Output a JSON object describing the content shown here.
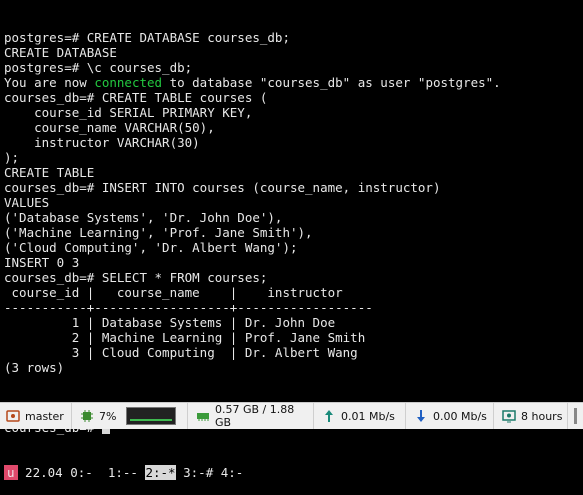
{
  "terminal": {
    "lines": [
      "postgres=# CREATE DATABASE courses_db;",
      "CREATE DATABASE",
      "postgres=# \\c courses_db;",
      {
        "pre": "You are now ",
        "hl": "connected",
        "post": " to database \"courses_db\" as user \"postgres\"."
      },
      "courses_db=# CREATE TABLE courses (",
      "    course_id SERIAL PRIMARY KEY,",
      "    course_name VARCHAR(50),",
      "    instructor VARCHAR(30)",
      ");",
      "CREATE TABLE",
      "courses_db=# INSERT INTO courses (course_name, instructor)",
      "VALUES",
      "('Database Systems', 'Dr. John Doe'),",
      "('Machine Learning', 'Prof. Jane Smith'),",
      "('Cloud Computing', 'Dr. Albert Wang');",
      "INSERT 0 3",
      "courses_db=# SELECT * FROM courses;",
      " course_id |   course_name    |    instructor",
      "-----------+------------------+------------------",
      "         1 | Database Systems | Dr. John Doe",
      "         2 | Machine Learning | Prof. Jane Smith",
      "         3 | Cloud Computing  | Dr. Albert Wang",
      "(3 rows)",
      ""
    ],
    "prompt": "courses_db=# "
  },
  "tmux": {
    "session": "u",
    "segments": [
      {
        "text": " 22.04 0:-  1:--",
        "active": false
      },
      {
        "text": "2:-*",
        "active": true
      },
      {
        "text": "3:-# 4:-",
        "active": false
      }
    ]
  },
  "statusbar": {
    "branch": "master",
    "cpu": "7%",
    "memory": "0.57 GB / 1.88 GB",
    "upload": "0.01 Mb/s",
    "download": "0.00 Mb/s",
    "uptime": "8 hours"
  },
  "colors": {
    "accent_green": "#23c840",
    "tmux_session": "#e0496b"
  }
}
